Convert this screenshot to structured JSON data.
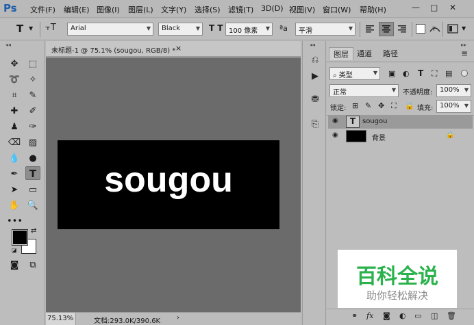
{
  "app": {
    "logo": "Ps"
  },
  "menu": [
    "文件(F)",
    "编辑(E)",
    "图像(I)",
    "图层(L)",
    "文字(Y)",
    "选择(S)",
    "滤镜(T)",
    "3D(D)",
    "视图(V)",
    "窗口(W)",
    "帮助(H)"
  ],
  "window_controls": {
    "minimize": "—",
    "maximize": "□",
    "close": "✕"
  },
  "options": {
    "tool_icon": "T",
    "orient_icon": "⫟T",
    "font_family": "Arial",
    "font_style": "Black",
    "size_icon": "T T",
    "font_size": "100 像素",
    "aa_icon": "ªa",
    "antialias": "平滑",
    "text_color": "#ffffff"
  },
  "document": {
    "tab_title": "未标题-1 @ 75.1% (sougou, RGB/8) *",
    "tab_close": "×",
    "text": "sougou",
    "zoom": "75.13%",
    "doc_size": "文档:293.0K/390.6K",
    "bg_color": "#000000"
  },
  "layers_panel": {
    "tabs": [
      "图层",
      "通道",
      "路径"
    ],
    "filter_label": "类型",
    "blend_mode": "正常",
    "opacity_label": "不透明度:",
    "opacity": "100%",
    "lock_label": "锁定:",
    "fill_label": "填充:",
    "fill": "100%",
    "layers": [
      {
        "name": "sougou",
        "type": "text"
      },
      {
        "name": "背景",
        "type": "background"
      }
    ]
  },
  "watermark": {
    "title": "百科全说",
    "subtitle": "助你轻松解决"
  },
  "colors": {
    "accent": "#2bb24c",
    "foreground": "#000000",
    "background": "#ffffff"
  }
}
